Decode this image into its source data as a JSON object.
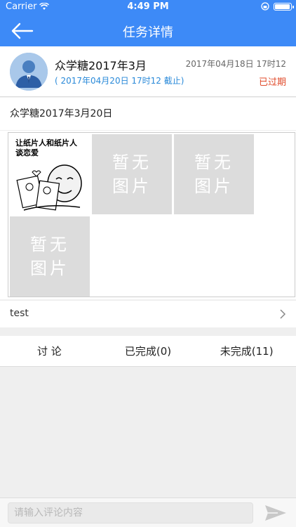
{
  "status_bar": {
    "carrier": "Carrier",
    "time": "4:49 PM",
    "battery_level": 0.95
  },
  "nav": {
    "title": "任务详情",
    "back_icon": "arrow-left-icon"
  },
  "task": {
    "title": "众学糖2017年3月",
    "deadline": "( 2017年04月20日 17时12 截止)",
    "created": "2017年04月18日 17时12",
    "status": "已过期",
    "status_color": "#e04b2b",
    "description": "众学糖2017年3月20日"
  },
  "gallery": {
    "image_caption": "让纸片人和纸片人\n谈恋爱",
    "placeholders": [
      "暂无\n图片",
      "暂无\n图片",
      "暂无\n图片"
    ]
  },
  "attachment": {
    "label": "test"
  },
  "tabs": [
    "讨 论",
    "已完成(0)",
    "未完成(11)"
  ],
  "comment": {
    "placeholder": "请输入评论内容"
  },
  "colors": {
    "accent": "#3d8af7",
    "link_blue": "#2a8ad9"
  }
}
